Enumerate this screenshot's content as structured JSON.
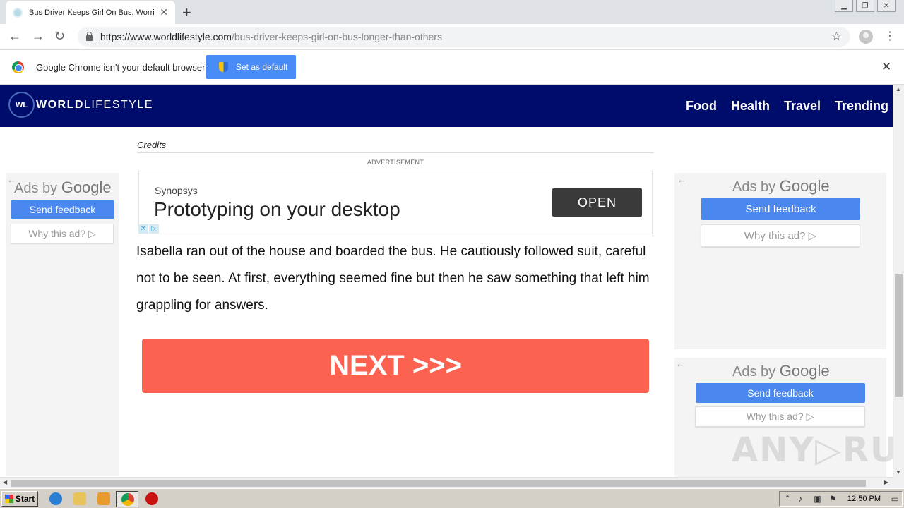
{
  "browser": {
    "tab_title": "Bus Driver Keeps Girl On Bus, Worrie",
    "tab_close": "✕",
    "new_tab": "+",
    "url_host": "https://www.worldlifestyle.com",
    "url_path": "/bus-driver-keeps-girl-on-bus-longer-than-others"
  },
  "infobar": {
    "message": "Google Chrome isn't your default browser",
    "button": "Set as default",
    "close": "✕"
  },
  "site": {
    "logo_badge": "WL",
    "logo_bold": "WORLD",
    "logo_rest": "LIFESTYLE",
    "nav": [
      "Food",
      "Health",
      "Travel",
      "Trending"
    ]
  },
  "article": {
    "credits": "Credits",
    "ad_label": "ADVERTISEMENT",
    "paragraph": "Isabella ran out of the house and boarded the bus. He cautiously followed suit, careful not to be seen. At first, everything seemed fine but then he saw something that left him grappling for answers.",
    "next_button": "NEXT >>>"
  },
  "banner_ad": {
    "brand": "Synopsys",
    "headline": "Prototyping on your desktop",
    "cta": "OPEN"
  },
  "google_ads": [
    {
      "ads_by": "Ads by ",
      "google": "Google",
      "feedback": "Send feedback",
      "why": "Why this ad? ▷"
    },
    {
      "ads_by": "Ads by ",
      "google": "Google",
      "feedback": "Send feedback",
      "why": "Why this ad? ▷"
    },
    {
      "ads_by": "Ads by ",
      "google": "Google",
      "feedback": "Send feedback",
      "why": "Why this ad? ▷"
    }
  ],
  "watermark": "ANY▷RUN",
  "taskbar": {
    "start": "Start",
    "clock": "12:50 PM"
  },
  "colors": {
    "header_bg": "#000c6b",
    "next_button": "#fd6250",
    "feedback_button": "#4a88f0",
    "set_default_button": "#4a8cf7"
  }
}
